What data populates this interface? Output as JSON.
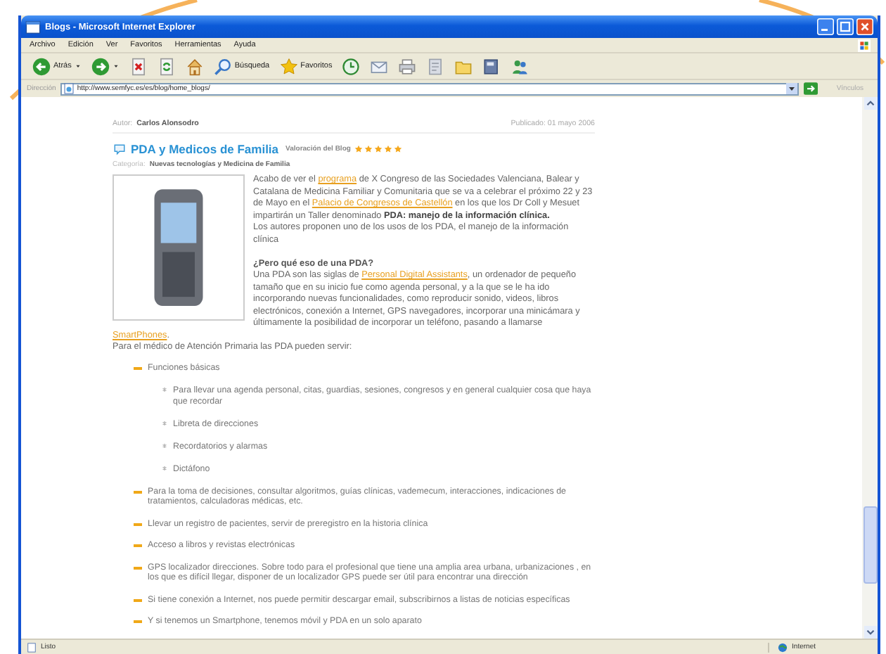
{
  "window": {
    "title": "Blogs - Microsoft Internet Explorer"
  },
  "menu": [
    "Archivo",
    "Edición",
    "Ver",
    "Favoritos",
    "Herramientas",
    "Ayuda"
  ],
  "toolbar": [
    {
      "kind": "back",
      "label": "Atrás"
    },
    {
      "kind": "forward"
    },
    {
      "kind": "stop"
    },
    {
      "kind": "refresh"
    },
    {
      "kind": "home"
    },
    {
      "kind": "search",
      "label": "Búsqueda"
    },
    {
      "kind": "favorites",
      "label": "Favoritos"
    },
    {
      "kind": "history"
    },
    {
      "kind": "mail"
    },
    {
      "kind": "print"
    },
    {
      "kind": "edit"
    },
    {
      "kind": "folder"
    },
    {
      "kind": "research"
    },
    {
      "kind": "messenger"
    }
  ],
  "address_bar": {
    "label": "Dirección",
    "value": "http://www.semfyc.es/es/blog/home_blogs/",
    "links": "Vínculos"
  },
  "post": {
    "author_label": "Autor:",
    "author": "Carlos Alonsodro",
    "date": "Publicado: 01 mayo 2006",
    "title": "PDA y Medicos de Familia",
    "rating_label": "Valoración del Blog",
    "stars": 5,
    "category_label": "Categoría:",
    "category": "Nuevas tecnologías y Medicina de Familia",
    "paragraphs": [
      {
        "kind": "text",
        "parts": [
          {
            "kind": "text",
            "text": "Acabo de ver el "
          },
          {
            "kind": "link",
            "text": "programa"
          },
          {
            "kind": "text",
            "text": " de X Congreso de las Sociedades Valenciana, Balear y Catalana de Medicina Familiar y Comunitaria que se va a celebrar el próximo 22 y 23 de Mayo en el "
          },
          {
            "kind": "link",
            "text": "Palacio de Congresos de Castellón"
          },
          {
            "kind": "text",
            "text": " en los que los Dr Coll y Mesuet impartirán un Taller  denominado "
          },
          {
            "kind": "bold",
            "text": "PDA: manejo de la información clínica."
          }
        ]
      },
      {
        "kind": "text",
        "parts": [
          {
            "kind": "text",
            "text": "Los autores proponen uno de los usos de los PDA, el manejo de la información clínica"
          }
        ]
      },
      {
        "kind": "heading",
        "parts": [
          {
            "kind": "text",
            "text": "¿Pero qué eso de una PDA?"
          }
        ]
      },
      {
        "kind": "text",
        "parts": [
          {
            "kind": "text",
            "text": "Una PDA son las siglas de "
          },
          {
            "kind": "link",
            "text": "Personal Digital Assistants"
          },
          {
            "kind": "text",
            "text": ",  un ordenador de pequeño tamaño que en su inicio fue como agenda personal, y a la que se le ha ido incorporando nuevas funcionalidades, como reproducir sonido, videos, libros electrónicos, conexión a Internet, GPS navegadores, incorporar una minicámara y últimamente la posibilidad de incorporar un teléfono, pasando a llamarse "
          },
          {
            "kind": "link",
            "text": "SmartPhones"
          },
          {
            "kind": "text",
            "text": "."
          }
        ]
      },
      {
        "kind": "text",
        "parts": [
          {
            "kind": "text",
            "text": "Para el médico de Atención Primaria  las PDA pueden servir:"
          }
        ]
      }
    ],
    "list": [
      {
        "text": "Funciones básicas",
        "children": [
          {
            "text": "Para llevar una agenda personal, citas, guardias, sesiones, congresos y en general cualquier cosa que haya que recordar"
          },
          {
            "text": "Libreta de direcciones"
          },
          {
            "text": "Recordatorios y alarmas"
          },
          {
            "text": "Dictáfono"
          }
        ]
      },
      {
        "text": "Para la toma de decisiones, consultar algoritmos, guías clínicas, vademecum, interacciones, indicaciones de tratamientos, calculadoras médicas, etc."
      },
      {
        "text": "Llevar un registro de pacientes, servir de preregistro en la historia clínica"
      },
      {
        "text": "Acceso a libros y revistas electrónicas"
      },
      {
        "text": "GPS localizador direcciones. Sobre todo para el profesional que tiene una amplia area urbana, urbanizaciones , en los que es difícil llegar, disponer de un localizador GPS puede ser útil para encontrar una dirección"
      },
      {
        "text": "Si tiene conexión a Internet, nos puede permitir descargar email, subscribirnos a listas de noticias específicas"
      },
      {
        "text": "Y si tenemos un Smartphone, tenemos móvil y PDA en un solo aparato"
      }
    ]
  },
  "status_bar": {
    "text": "Listo",
    "zone": "Internet"
  }
}
